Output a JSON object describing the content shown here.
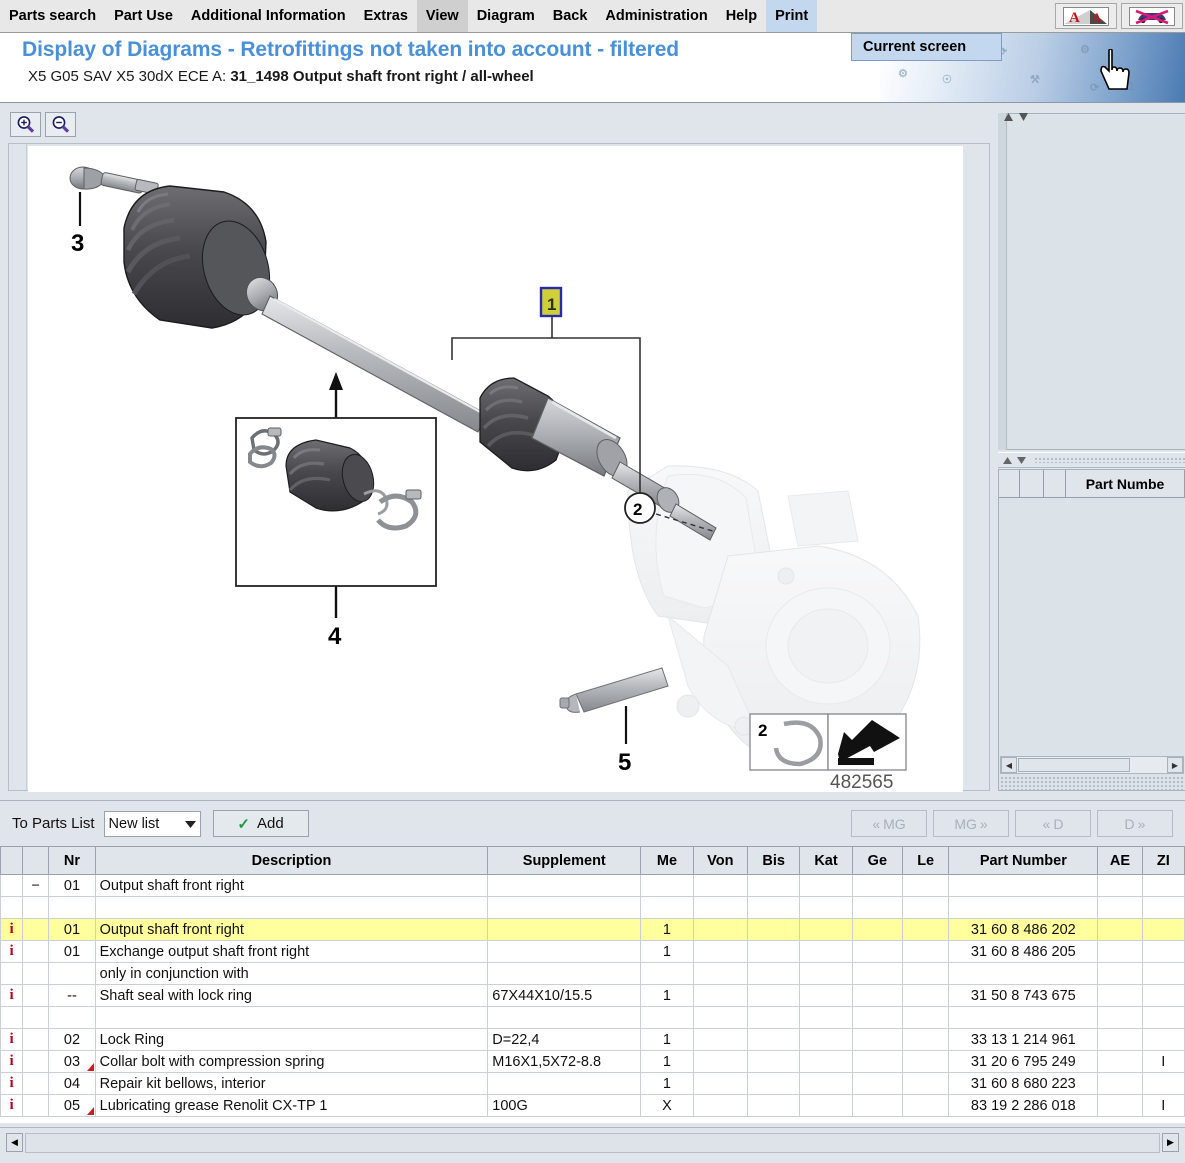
{
  "menu": {
    "items": [
      {
        "label": "Parts search",
        "state": "normal"
      },
      {
        "label": "Part Use",
        "state": "normal"
      },
      {
        "label": "Additional Information",
        "state": "normal"
      },
      {
        "label": "Extras",
        "state": "normal"
      },
      {
        "label": "View",
        "state": "hover"
      },
      {
        "label": "Diagram",
        "state": "normal"
      },
      {
        "label": "Back",
        "state": "normal"
      },
      {
        "label": "Administration",
        "state": "normal"
      },
      {
        "label": "Help",
        "state": "normal"
      },
      {
        "label": "Print",
        "state": "open"
      }
    ],
    "dropdown": {
      "label": "Current screen"
    },
    "toolbar_icons": [
      {
        "name": "font-size-icon",
        "glyph": "A"
      },
      {
        "name": "vehicle-crossed-out-icon",
        "glyph": "car"
      }
    ]
  },
  "header": {
    "title": "Display of Diagrams - Retrofittings not taken into account - filtered",
    "subtitle_plain": "X5 G05 SAV X5 30dX ECE  A: ",
    "subtitle_bold": "31_1498 Output shaft front right / all-wheel"
  },
  "diagram": {
    "zoom_in": "+",
    "zoom_out": "−",
    "drawing_number": "482565",
    "callouts": [
      {
        "id": "1",
        "selected": true
      },
      {
        "id": "2",
        "selected": false
      },
      {
        "id": "3",
        "selected": false
      },
      {
        "id": "4",
        "selected": false
      },
      {
        "id": "5",
        "selected": false
      }
    ],
    "legend_callout": "2"
  },
  "right_panel": {
    "part_number_header": "Part Numbe"
  },
  "parts_toolbar": {
    "to_parts_list_label": "To Parts List",
    "list_select_value": "New list",
    "add_label": "Add",
    "nav_buttons": [
      {
        "label": "MG",
        "dir": "prev",
        "enabled": false
      },
      {
        "label": "MG",
        "dir": "next",
        "enabled": false
      },
      {
        "label": "D",
        "dir": "prev",
        "enabled": false
      },
      {
        "label": "D",
        "dir": "next",
        "enabled": false
      }
    ]
  },
  "table": {
    "columns": [
      "",
      "",
      "Nr",
      "Description",
      "Supplement",
      "Me",
      "Von",
      "Bis",
      "Kat",
      "Ge",
      "Le",
      "Part Number",
      "AE",
      "ZI"
    ],
    "rows": [
      {
        "info": "",
        "exp": "−",
        "nr": "01",
        "desc": "Output shaft front right",
        "sup": "",
        "me": "",
        "von": "",
        "bis": "",
        "kat": "",
        "ge": "",
        "le": "",
        "pn": "",
        "ae": "",
        "zi": "",
        "highlight": false,
        "triangle": false
      },
      {
        "info": "",
        "exp": "",
        "nr": "",
        "desc": "",
        "sup": "",
        "me": "",
        "von": "",
        "bis": "",
        "kat": "",
        "ge": "",
        "le": "",
        "pn": "",
        "ae": "",
        "zi": "",
        "highlight": false,
        "triangle": false
      },
      {
        "info": "i",
        "exp": "",
        "nr": "01",
        "desc": "Output shaft front right",
        "sup": "",
        "me": "1",
        "von": "",
        "bis": "",
        "kat": "",
        "ge": "",
        "le": "",
        "pn": "31 60 8 486 202",
        "ae": "",
        "zi": "",
        "highlight": true,
        "triangle": false
      },
      {
        "info": "i",
        "exp": "",
        "nr": "01",
        "desc": "Exchange output shaft front right",
        "sup": "",
        "me": "1",
        "von": "",
        "bis": "",
        "kat": "",
        "ge": "",
        "le": "",
        "pn": "31 60 8 486 205",
        "ae": "",
        "zi": "",
        "highlight": false,
        "triangle": false
      },
      {
        "info": "",
        "exp": "",
        "nr": "",
        "desc": "only in conjunction with",
        "sup": "",
        "me": "",
        "von": "",
        "bis": "",
        "kat": "",
        "ge": "",
        "le": "",
        "pn": "",
        "ae": "",
        "zi": "",
        "highlight": false,
        "triangle": false
      },
      {
        "info": "i",
        "exp": "",
        "nr": "--",
        "desc": "Shaft seal with lock ring",
        "sup": "67X44X10/15.5",
        "me": "1",
        "von": "",
        "bis": "",
        "kat": "",
        "ge": "",
        "le": "",
        "pn": "31 50 8 743 675",
        "ae": "",
        "zi": "",
        "highlight": false,
        "triangle": false
      },
      {
        "info": "",
        "exp": "",
        "nr": "",
        "desc": "",
        "sup": "",
        "me": "",
        "von": "",
        "bis": "",
        "kat": "",
        "ge": "",
        "le": "",
        "pn": "",
        "ae": "",
        "zi": "",
        "highlight": false,
        "triangle": false
      },
      {
        "info": "i",
        "exp": "",
        "nr": "02",
        "desc": "Lock Ring",
        "sup": "D=22,4",
        "me": "1",
        "von": "",
        "bis": "",
        "kat": "",
        "ge": "",
        "le": "",
        "pn": "33 13 1 214 961",
        "ae": "",
        "zi": "",
        "highlight": false,
        "triangle": false
      },
      {
        "info": "i",
        "exp": "",
        "nr": "03",
        "desc": "Collar bolt with compression spring",
        "sup": "M16X1,5X72-8.8",
        "me": "1",
        "von": "",
        "bis": "",
        "kat": "",
        "ge": "",
        "le": "",
        "pn": "31 20 6 795 249",
        "ae": "",
        "zi": "I",
        "highlight": false,
        "triangle": true
      },
      {
        "info": "i",
        "exp": "",
        "nr": "04",
        "desc": "Repair kit bellows, interior",
        "sup": "",
        "me": "1",
        "von": "",
        "bis": "",
        "kat": "",
        "ge": "",
        "le": "",
        "pn": "31 60 8 680 223",
        "ae": "",
        "zi": "",
        "highlight": false,
        "triangle": false
      },
      {
        "info": "i",
        "exp": "",
        "nr": "05",
        "desc": "Lubricating grease Renolit CX-TP 1",
        "sup": "100G",
        "me": "X",
        "von": "",
        "bis": "",
        "kat": "",
        "ge": "",
        "le": "",
        "pn": "83 19 2 286 018",
        "ae": "",
        "zi": "I",
        "highlight": false,
        "triangle": true
      }
    ]
  },
  "colors": {
    "title_blue": "#4a90d9",
    "highlight_yellow": "#ffff9e",
    "info_red": "#b3001b",
    "panel_bg": "#dfe5ea",
    "menu_open_blue": "#c3d8ef"
  }
}
